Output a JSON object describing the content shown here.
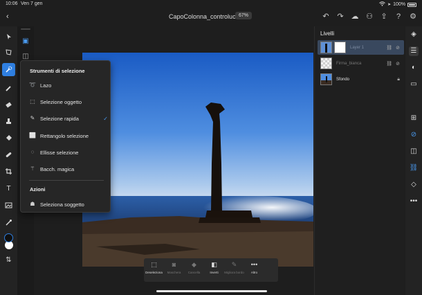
{
  "status_bar": {
    "time": "10:06",
    "date": "Ven 7 gen",
    "battery": "100%"
  },
  "document": {
    "title": "CapoColonna_controluce",
    "zoom": "67%"
  },
  "selection_popup": {
    "heading": "Strumenti di selezione",
    "items": [
      {
        "label": "Lazo",
        "icon": "lasso-icon",
        "checked": false
      },
      {
        "label": "Selezione oggetto",
        "icon": "object-selection-icon",
        "checked": false
      },
      {
        "label": "Selezione rapida",
        "icon": "quick-selection-icon",
        "checked": true
      },
      {
        "label": "Rettangolo selezione",
        "icon": "rectangle-selection-icon",
        "checked": false
      },
      {
        "label": "Ellisse selezione",
        "icon": "ellipse-selection-icon",
        "checked": false
      },
      {
        "label": "Bacch. magica",
        "icon": "magic-wand-icon",
        "checked": false
      }
    ],
    "actions_heading": "Azioni",
    "actions": [
      {
        "label": "Seleziona soggetto",
        "icon": "select-subject-icon"
      }
    ]
  },
  "context_bar": {
    "items": [
      {
        "label": "Deseleziona",
        "icon": "deselect-icon",
        "enabled": true
      },
      {
        "label": "Maschera",
        "icon": "mask-icon",
        "enabled": false
      },
      {
        "label": "Cancella",
        "icon": "eraser-icon",
        "enabled": false
      },
      {
        "label": "Inverti",
        "icon": "invert-icon",
        "enabled": true
      },
      {
        "label": "Migliora bordo",
        "icon": "refine-edge-icon",
        "enabled": false
      },
      {
        "label": "Altro",
        "icon": "more-icon",
        "enabled": true
      }
    ]
  },
  "layers_panel": {
    "title": "Livelli",
    "layers": [
      {
        "name": "Layer 1",
        "selected": true,
        "has_mask": true
      },
      {
        "name": "Firma_bianca",
        "selected": false,
        "has_mask": false
      },
      {
        "name": "Sfondo",
        "selected": false,
        "locked": true
      }
    ]
  },
  "colors": {
    "accent": "#2f7fe0",
    "foreground_color": "#000000",
    "background_color": "#ffffff"
  }
}
